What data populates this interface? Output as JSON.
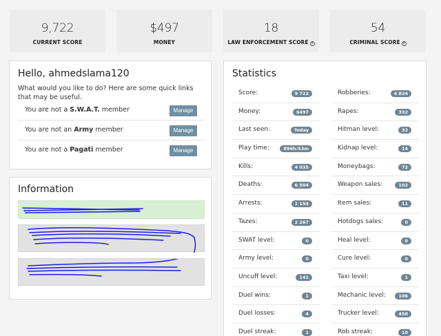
{
  "top_stats": [
    {
      "value": "9,722",
      "label": "CURRENT SCORE",
      "help": false
    },
    {
      "value": "$497",
      "label": "MONEY",
      "help": false
    },
    {
      "value": "18",
      "label": "LAW ENFORCEMENT SCORE",
      "help": true
    },
    {
      "value": "54",
      "label": "CRIMINAL SCORE",
      "help": true
    }
  ],
  "hello": {
    "title": "Hello, ahmedslama120",
    "intro": "What would you like to do? Here are some quick links that may be useful.",
    "rows": [
      {
        "prefix": "You are not a ",
        "group": "S.W.A.T.",
        "suffix": " member",
        "button": "Manage"
      },
      {
        "prefix": "You are not an ",
        "group": "Army",
        "suffix": " member",
        "button": "Manage"
      },
      {
        "prefix": "You are not a ",
        "group": "Pagati",
        "suffix": " member",
        "button": "Manage"
      }
    ]
  },
  "information": {
    "title": "Information"
  },
  "statistics": {
    "title": "Statistics",
    "left": [
      {
        "label": "Score:",
        "value": "9 722"
      },
      {
        "label": "Money:",
        "value": "$497"
      },
      {
        "label": "Last seen:",
        "value": "Today"
      },
      {
        "label": "Play time:",
        "value": "896h:53m"
      },
      {
        "label": "Kills:",
        "value": "4 035"
      },
      {
        "label": "Deaths:",
        "value": "6 504"
      },
      {
        "label": "Arrests:",
        "value": "1 154"
      },
      {
        "label": "Tazes:",
        "value": "2 267"
      },
      {
        "label": "SWAT level:",
        "value": "0"
      },
      {
        "label": "Army level:",
        "value": "0"
      },
      {
        "label": "Uncuff level:",
        "value": "141"
      },
      {
        "label": "Duel wins:",
        "value": "1"
      },
      {
        "label": "Duel losses:",
        "value": "4"
      },
      {
        "label": "Duel streak:",
        "value": "1"
      }
    ],
    "right": [
      {
        "label": "Robberies:",
        "value": "4 824"
      },
      {
        "label": "Rapes:",
        "value": "332"
      },
      {
        "label": "Hitman level:",
        "value": "32"
      },
      {
        "label": "Kidnap level:",
        "value": "14"
      },
      {
        "label": "Moneybags:",
        "value": "72"
      },
      {
        "label": "Weapon sales:",
        "value": "102"
      },
      {
        "label": "Item sales:",
        "value": "11"
      },
      {
        "label": "Hotdogs sales:",
        "value": "0"
      },
      {
        "label": "Heal level:",
        "value": "0"
      },
      {
        "label": "Cure level:",
        "value": "0"
      },
      {
        "label": "Taxi level:",
        "value": "1"
      },
      {
        "label": "Mechanic level:",
        "value": "106"
      },
      {
        "label": "Trucker level:",
        "value": "458"
      },
      {
        "label": "Rob streak:",
        "value": "10"
      }
    ]
  },
  "colors": {
    "badge": "#6f8594",
    "manage_button": "#6f8fa3",
    "success_box": "#d8efd3",
    "scribble": "#1c1cf0"
  }
}
